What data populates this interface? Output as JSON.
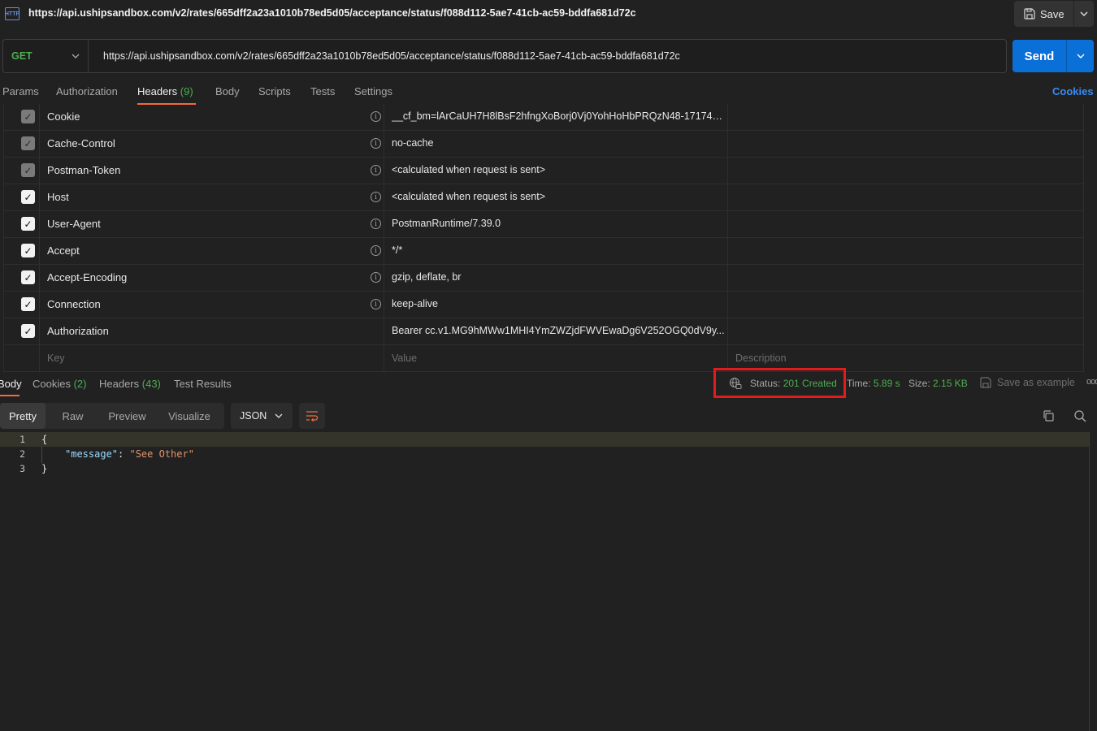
{
  "request": {
    "title": "https://api.ushipsandbox.com/v2/rates/665dff2a23a1010b78ed5d05/acceptance/status/f088d112-5ae7-41cb-ac59-bddfa681d72c",
    "icon_label": "HTTP",
    "save_label": "Save",
    "method": "GET",
    "url": "https://api.ushipsandbox.com/v2/rates/665dff2a23a1010b78ed5d05/acceptance/status/f088d112-5ae7-41cb-ac59-bddfa681d72c",
    "send_label": "Send"
  },
  "req_tabs": {
    "params": "Params",
    "authorization": "Authorization",
    "headers": "Headers",
    "headers_count": "(9)",
    "body": "Body",
    "scripts": "Scripts",
    "tests": "Tests",
    "settings": "Settings",
    "cookies": "Cookies"
  },
  "headers": [
    {
      "key": "Cookie",
      "value": "__cf_bm=lArCaUH7H8lBsF2hfngXoBorj0Vj0YohHoHbPRQzN48-171743...",
      "checked": "dim",
      "info": true
    },
    {
      "key": "Cache-Control",
      "value": "no-cache",
      "checked": "dim",
      "info": true
    },
    {
      "key": "Postman-Token",
      "value": "<calculated when request is sent>",
      "checked": "dim",
      "info": true
    },
    {
      "key": "Host",
      "value": "<calculated when request is sent>",
      "checked": "on",
      "info": true
    },
    {
      "key": "User-Agent",
      "value": "PostmanRuntime/7.39.0",
      "checked": "on",
      "info": true
    },
    {
      "key": "Accept",
      "value": "*/*",
      "checked": "on",
      "info": true
    },
    {
      "key": "Accept-Encoding",
      "value": "gzip, deflate, br",
      "checked": "on",
      "info": true
    },
    {
      "key": "Connection",
      "value": "keep-alive",
      "checked": "on",
      "info": true
    },
    {
      "key": "Authorization",
      "value": "Bearer cc.v1.MG9hMWw1MHI4YmZWZjdFWVEwaDg6V252OGQ0dV9y...",
      "checked": "on",
      "info": false
    }
  ],
  "placeholders": {
    "key": "Key",
    "value": "Value",
    "description": "Description"
  },
  "resp_tabs": {
    "body": "Body",
    "cookies": "Cookies",
    "cookies_count": "(2)",
    "headers": "Headers",
    "headers_count": "(43)",
    "test_results": "Test Results"
  },
  "status": {
    "label": "Status:",
    "value": "201 Created",
    "time_label": "Time:",
    "time_value": "5.89 s",
    "size_label": "Size:",
    "size_value": "2.15 KB",
    "save_example": "Save as example",
    "more": "ooo"
  },
  "format": {
    "pretty": "Pretty",
    "raw": "Raw",
    "preview": "Preview",
    "visualize": "Visualize",
    "language": "JSON"
  },
  "code": {
    "line1": "{",
    "line2_key": "\"message\"",
    "line2_sep": ": ",
    "line2_value": "\"See Other\"",
    "line3": "}",
    "n1": "1",
    "n2": "2",
    "n3": "3"
  },
  "colors": {
    "accent": "#f26b3a",
    "send": "#0a6fd6",
    "success": "#4caf50",
    "highlight_box": "#e01c1c"
  }
}
